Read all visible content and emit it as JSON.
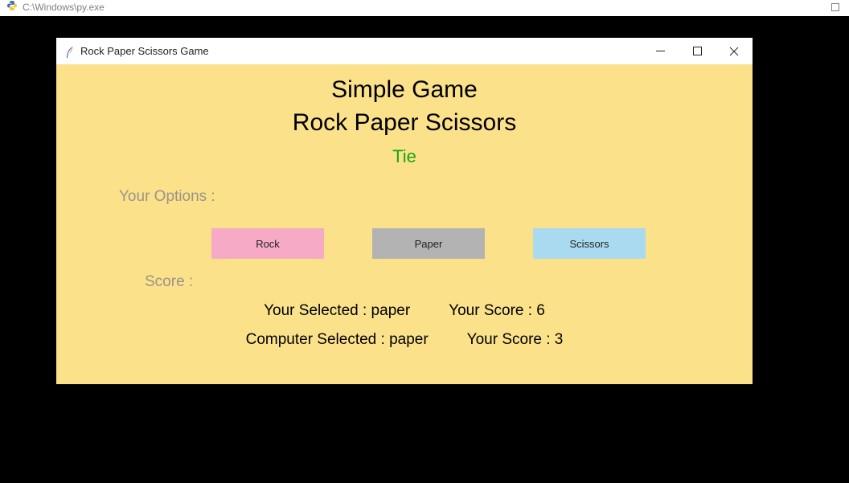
{
  "outer": {
    "title": "C:\\Windows\\py.exe"
  },
  "window": {
    "title": "Rock Paper Scissors Game"
  },
  "app": {
    "heading1": "Simple Game",
    "heading2": "Rock Paper Scissors",
    "result_text": "Tie",
    "options_label": "Your Options :",
    "score_label": "Score :",
    "buttons": {
      "rock": "Rock",
      "paper": "Paper",
      "scissors": "Scissors"
    },
    "your_selected": "Your Selected : paper",
    "your_score": "Your Score : 6",
    "computer_selected": "Computer Selected : paper",
    "computer_score": "Your Score : 3"
  }
}
